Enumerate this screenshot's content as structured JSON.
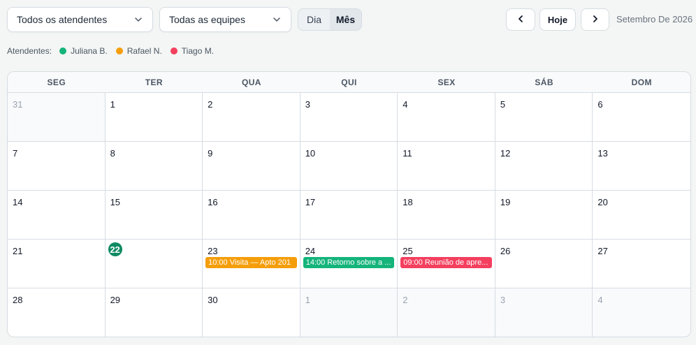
{
  "filters": {
    "attendants": {
      "selected": "Todos os atendentes",
      "icon": "chevron-down-icon"
    },
    "teams": {
      "selected": "Todas as equipes",
      "icon": "chevron-down-icon"
    }
  },
  "view_toggle": {
    "day": "Dia",
    "month": "Mês",
    "active": "month"
  },
  "nav": {
    "prev_icon": "chevron-left-icon",
    "today_label": "Hoje",
    "next_icon": "chevron-right-icon",
    "current_month": "Setembro De 2026"
  },
  "legend": {
    "title": "Atendentes:",
    "items": [
      {
        "name": "Juliana B.",
        "color": "#14b47a"
      },
      {
        "name": "Rafael N.",
        "color": "#f59e0b"
      },
      {
        "name": "Tiago M.",
        "color": "#f43f5e"
      }
    ]
  },
  "calendar": {
    "weekdays": [
      "SEG",
      "TER",
      "QUA",
      "QUI",
      "SEX",
      "SÁB",
      "DOM"
    ],
    "weeks": [
      [
        {
          "day": "31",
          "muted": true
        },
        {
          "day": "1"
        },
        {
          "day": "2"
        },
        {
          "day": "3"
        },
        {
          "day": "4"
        },
        {
          "day": "5"
        },
        {
          "day": "6"
        }
      ],
      [
        {
          "day": "7"
        },
        {
          "day": "8"
        },
        {
          "day": "9"
        },
        {
          "day": "10"
        },
        {
          "day": "11"
        },
        {
          "day": "12"
        },
        {
          "day": "13"
        }
      ],
      [
        {
          "day": "14"
        },
        {
          "day": "15"
        },
        {
          "day": "16"
        },
        {
          "day": "17"
        },
        {
          "day": "18"
        },
        {
          "day": "19"
        },
        {
          "day": "20"
        }
      ],
      [
        {
          "day": "21"
        },
        {
          "day": "22",
          "today": true
        },
        {
          "day": "23",
          "events": [
            {
              "text": "10:00 Visita — Apto 201",
              "color": "#f59e0b"
            }
          ]
        },
        {
          "day": "24",
          "events": [
            {
              "text": "14:00 Retorno sobre a ...",
              "color": "#14b47a"
            }
          ]
        },
        {
          "day": "25",
          "events": [
            {
              "text": "09:00 Reunião de apre...",
              "color": "#f43f5e"
            }
          ]
        },
        {
          "day": "26"
        },
        {
          "day": "27"
        }
      ],
      [
        {
          "day": "28"
        },
        {
          "day": "29"
        },
        {
          "day": "30"
        },
        {
          "day": "1",
          "muted": true
        },
        {
          "day": "2",
          "muted": true
        },
        {
          "day": "3",
          "muted": true
        },
        {
          "day": "4",
          "muted": true
        }
      ]
    ]
  }
}
